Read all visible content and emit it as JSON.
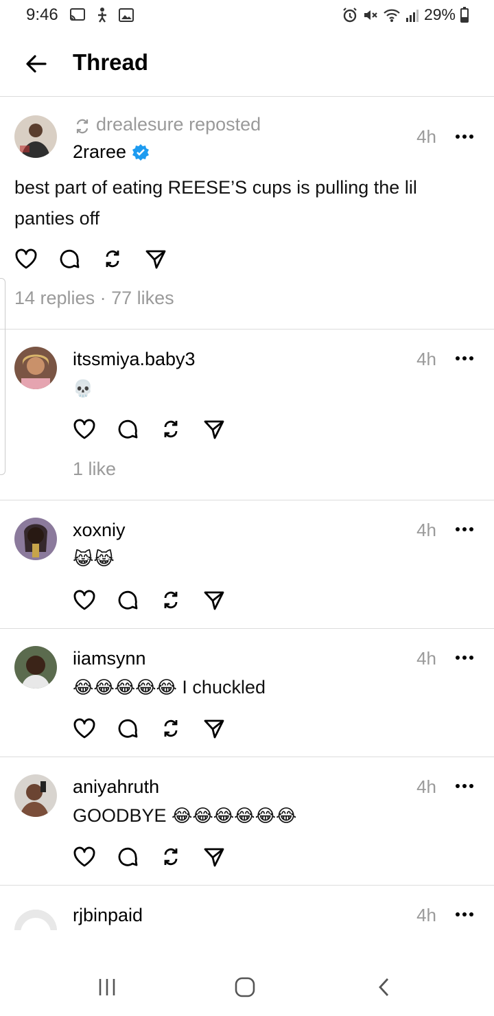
{
  "status_bar": {
    "time": "9:46",
    "battery": "29%"
  },
  "header": {
    "title": "Thread"
  },
  "main_post": {
    "repost_label": "drealesure reposted",
    "username": "2raree",
    "time": "4h",
    "text_line1": "best part of eating REESE’S cups is pulling the lil",
    "text_line2": "panties off",
    "stats": "14 replies · 77 likes"
  },
  "replies": [
    {
      "username": "itssmiya.baby3",
      "time": "4h",
      "text": "",
      "emojis": "💀",
      "stats": "1 like"
    },
    {
      "username": "xoxniy",
      "time": "4h",
      "text": "",
      "emojis": "😹😹",
      "stats": ""
    },
    {
      "username": "iiamsynn",
      "time": "4h",
      "text": "I chuckled",
      "emojis": "😂😂😂😂😂",
      "stats": ""
    },
    {
      "username": "aniyahruth",
      "time": "4h",
      "text": "GOODBYE",
      "emojis": "😂😂😂😂😂😂",
      "stats": ""
    },
    {
      "username": "rjbinpaid",
      "time": "4h",
      "text": "",
      "emojis": "",
      "stats": ""
    }
  ],
  "colors": {
    "verified": "#1d9bf0",
    "muted_text": "#9a9a9a",
    "divider": "#dcdcdc"
  }
}
